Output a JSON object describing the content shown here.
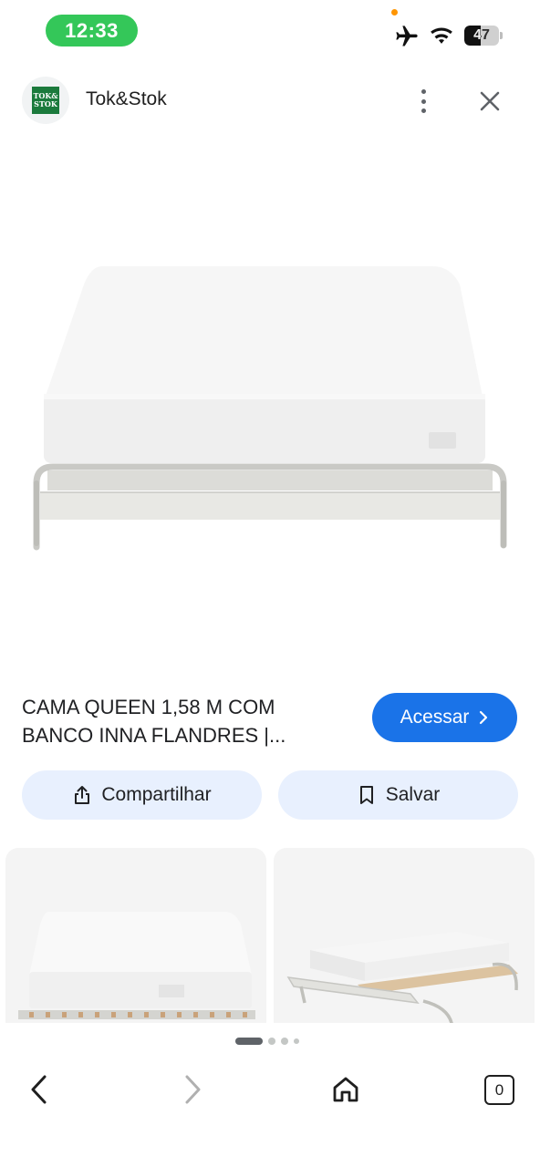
{
  "status_bar": {
    "time": "12:33",
    "battery_level": "47",
    "battery_fraction": 0.47,
    "icons": [
      "airplane-icon",
      "wifi-icon",
      "battery-icon"
    ]
  },
  "header": {
    "site_name": "Tok&Stok",
    "logo_text_line1": "TOK&",
    "logo_text_line2": "STOK",
    "icons": [
      "more-vertical-icon",
      "close-icon"
    ]
  },
  "product": {
    "title": "CAMA QUEEN 1,58 M COM BANCO INNA FLANDRES |..."
  },
  "buttons": {
    "access_label": "Acessar",
    "share_label": "Compartilhar",
    "save_label": "Salvar"
  },
  "carousel": {
    "count": 4,
    "active_index": 0
  },
  "bottom_nav": {
    "tab_count": "0",
    "icons": [
      "back-icon",
      "forward-icon",
      "home-icon",
      "tabs-icon"
    ]
  },
  "colors": {
    "accent": "#1a73e8",
    "pill_bg": "#e8f0fe",
    "time_pill": "#34c759",
    "logo_green": "#1b7a3c"
  }
}
